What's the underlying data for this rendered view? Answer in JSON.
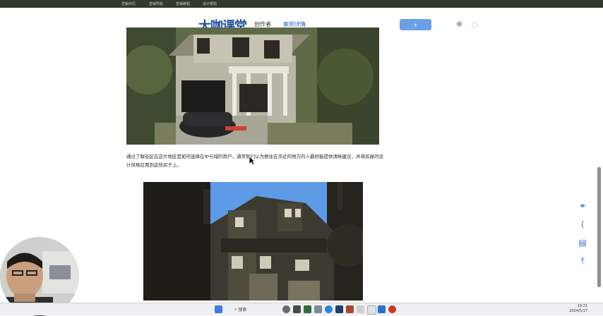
{
  "topbar": {
    "links": [
      "营销日历",
      "营销导航",
      "营销教程",
      "设计帮助"
    ]
  },
  "header": {
    "logo": "大咖课堂",
    "creator": "创作者",
    "case_detail": "案例详情",
    "button_label": "+"
  },
  "article": {
    "paragraph": "通过了解街区在这片地区是如何选择在中与城的用户，通常我们认为居住在邻近的地方的人最好能提供清晰建议，并将房屋的设计风格应用到这些房子上。"
  },
  "taskbar": {
    "search_label": "搜索",
    "time": "19:21",
    "date": "2024/5/17"
  },
  "colors": {
    "topbar": "#2f3a2c",
    "accent": "#2a66c6",
    "sky": "#5d9be6"
  }
}
